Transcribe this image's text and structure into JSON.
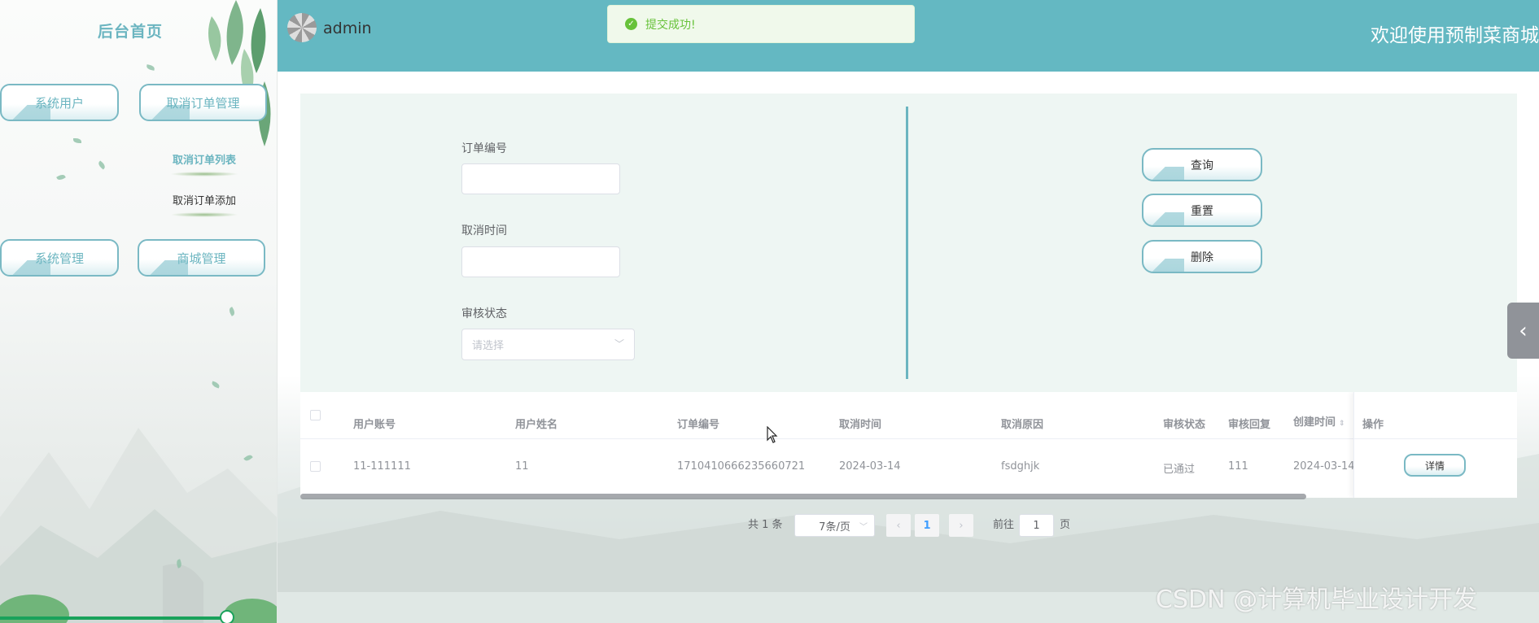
{
  "sidebar": {
    "title": "后台首页",
    "menu": {
      "system_users": "系统用户",
      "cancel_order_mgmt": "取消订单管理",
      "system_mgmt": "系统管理",
      "mall_mgmt": "商城管理"
    },
    "submenu": {
      "cancel_order_list": "取消订单列表",
      "cancel_order_add": "取消订单添加"
    }
  },
  "header": {
    "username": "admin",
    "welcome": "欢迎使用预制菜商城"
  },
  "toast": {
    "message": "提交成功!"
  },
  "search": {
    "order_no_label": "订单编号",
    "cancel_time_label": "取消时间",
    "review_status_label": "审核状态",
    "review_status_placeholder": "请选择",
    "buttons": {
      "query": "查询",
      "reset": "重置",
      "delete": "删除"
    }
  },
  "table": {
    "headers": {
      "user_account": "用户账号",
      "user_name": "用户姓名",
      "order_no": "订单编号",
      "cancel_time": "取消时间",
      "cancel_reason": "取消原因",
      "review_status": "审核状态",
      "review_reply": "审核回复",
      "created_time": "创建时间",
      "actions": "操作"
    },
    "rows": [
      {
        "user_account": "11-111111",
        "user_name": "11",
        "order_no": "1710410666235660721",
        "cancel_time": "2024-03-14",
        "cancel_reason": "fsdghjk",
        "review_status": "已通过",
        "review_reply": "111",
        "created_time": "2024-03-14",
        "detail_label": "详情"
      }
    ]
  },
  "pagination": {
    "total": "共 1 条",
    "page_size": "7条/页",
    "current_page": "1",
    "goto_prefix": "前往",
    "goto_value": "1",
    "goto_suffix": "页"
  },
  "watermark": "CSDN @计算机毕业设计开发",
  "colors": {
    "accent": "#64b8c2",
    "success": "#67c23a",
    "slider": "#19a25b"
  }
}
